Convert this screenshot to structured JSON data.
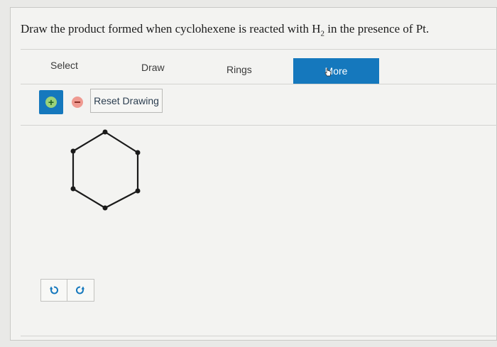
{
  "question": {
    "prefix": "Draw the product formed when cyclohexene is reacted with H",
    "subscript": "2",
    "suffix": " in the presence of Pt."
  },
  "toolbar": {
    "select_label": "Select",
    "draw_label": "Draw",
    "rings_label": "Rings",
    "more_label": "More"
  },
  "draw_panel": {
    "reset_label": "Reset Drawing"
  },
  "icons": {
    "add": "plus-circle-icon",
    "remove": "minus-circle-icon",
    "undo": "undo-icon",
    "redo": "redo-icon"
  },
  "colors": {
    "accent": "#1578bd",
    "add_green": "#9ad27a",
    "remove_red": "#ef9a91",
    "bond": "#1a1a1a"
  }
}
